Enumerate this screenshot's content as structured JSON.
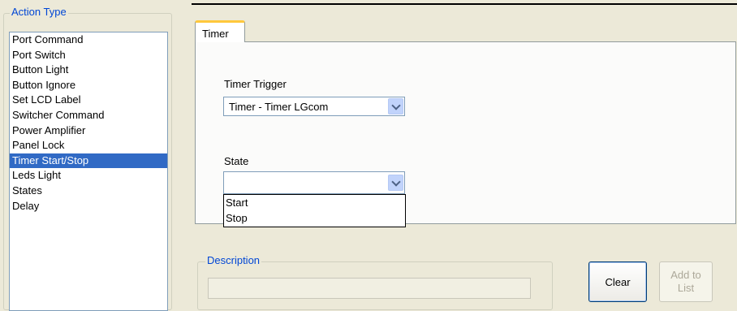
{
  "action_type": {
    "legend": "Action Type",
    "items": [
      "Port Command",
      "Port Switch",
      "Button Light",
      "Button Ignore",
      "Set LCD Label",
      "Switcher Command",
      "Power Amplifier",
      "Panel Lock",
      "Timer Start/Stop",
      "Leds Light",
      "States",
      "Delay"
    ],
    "selected": "Timer Start/Stop"
  },
  "tabs": {
    "active_label": "Timer"
  },
  "timer_trigger": {
    "label": "Timer Trigger",
    "value": "Timer - Timer LGcom"
  },
  "state": {
    "label": "State",
    "value": "",
    "options": [
      "Start",
      "Stop"
    ]
  },
  "description": {
    "legend": "Description",
    "value": ""
  },
  "buttons": {
    "clear_label": "Clear",
    "add_label_line1": "Add to",
    "add_label_line2": "List"
  },
  "colors": {
    "selection": "#316ac5",
    "legend_text": "#0046d5",
    "tab_highlight": "#ffc83c"
  }
}
